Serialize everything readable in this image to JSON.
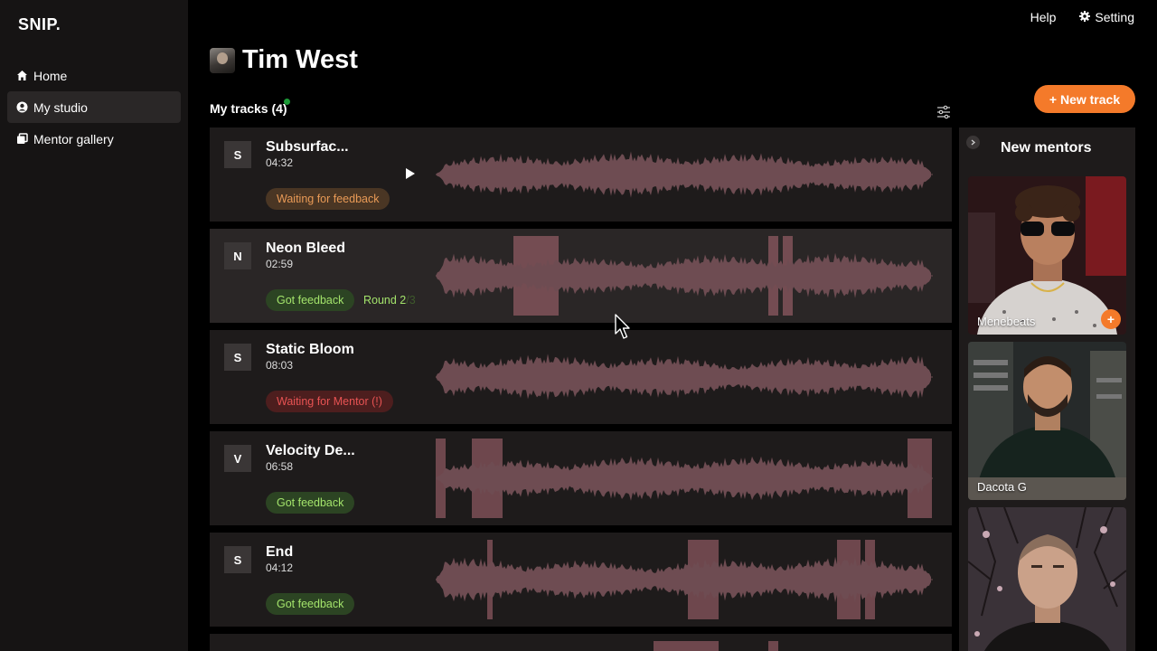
{
  "app": {
    "logo": "SNIP."
  },
  "nav": {
    "items": [
      {
        "label": "Home",
        "icon": "home-icon",
        "active": false
      },
      {
        "label": "My studio",
        "icon": "user-circle-icon",
        "active": true
      },
      {
        "label": "Mentor gallery",
        "icon": "gallery-icon",
        "active": false
      }
    ]
  },
  "topbar": {
    "help": "Help",
    "setting": "Setting"
  },
  "profile": {
    "name": "Tim West"
  },
  "tracks_header": {
    "title": "My tracks (4)"
  },
  "new_track_button": "+ New track",
  "tracks": [
    {
      "initial": "S",
      "name": "Subsurfac...",
      "duration": "04:32",
      "status": "Waiting for feedback",
      "status_color": "orange"
    },
    {
      "initial": "N",
      "name": "Neon Bleed",
      "duration": "02:59",
      "status": "Got feedback",
      "status_color": "green",
      "round_label": "Round 2",
      "round_total": "/3"
    },
    {
      "initial": "S",
      "name": "Static Bloom",
      "duration": "08:03",
      "status": "Waiting for Mentor (!)",
      "status_color": "red"
    },
    {
      "initial": "V",
      "name": "Velocity De...",
      "duration": "06:58",
      "status": "Got feedback",
      "status_color": "green"
    },
    {
      "initial": "S",
      "name": "End",
      "duration": "04:12",
      "status": "Got feedback",
      "status_color": "green"
    }
  ],
  "mentors": {
    "title": "New mentors",
    "items": [
      {
        "name": "Menebeats"
      },
      {
        "name": "Dacota G"
      },
      {
        "name": ""
      }
    ]
  },
  "colors": {
    "accent": "#f47a2a",
    "status_green": "#a3e36b",
    "status_orange": "#e99a56",
    "status_red": "#e85353",
    "waveform": "#6e4c52"
  }
}
